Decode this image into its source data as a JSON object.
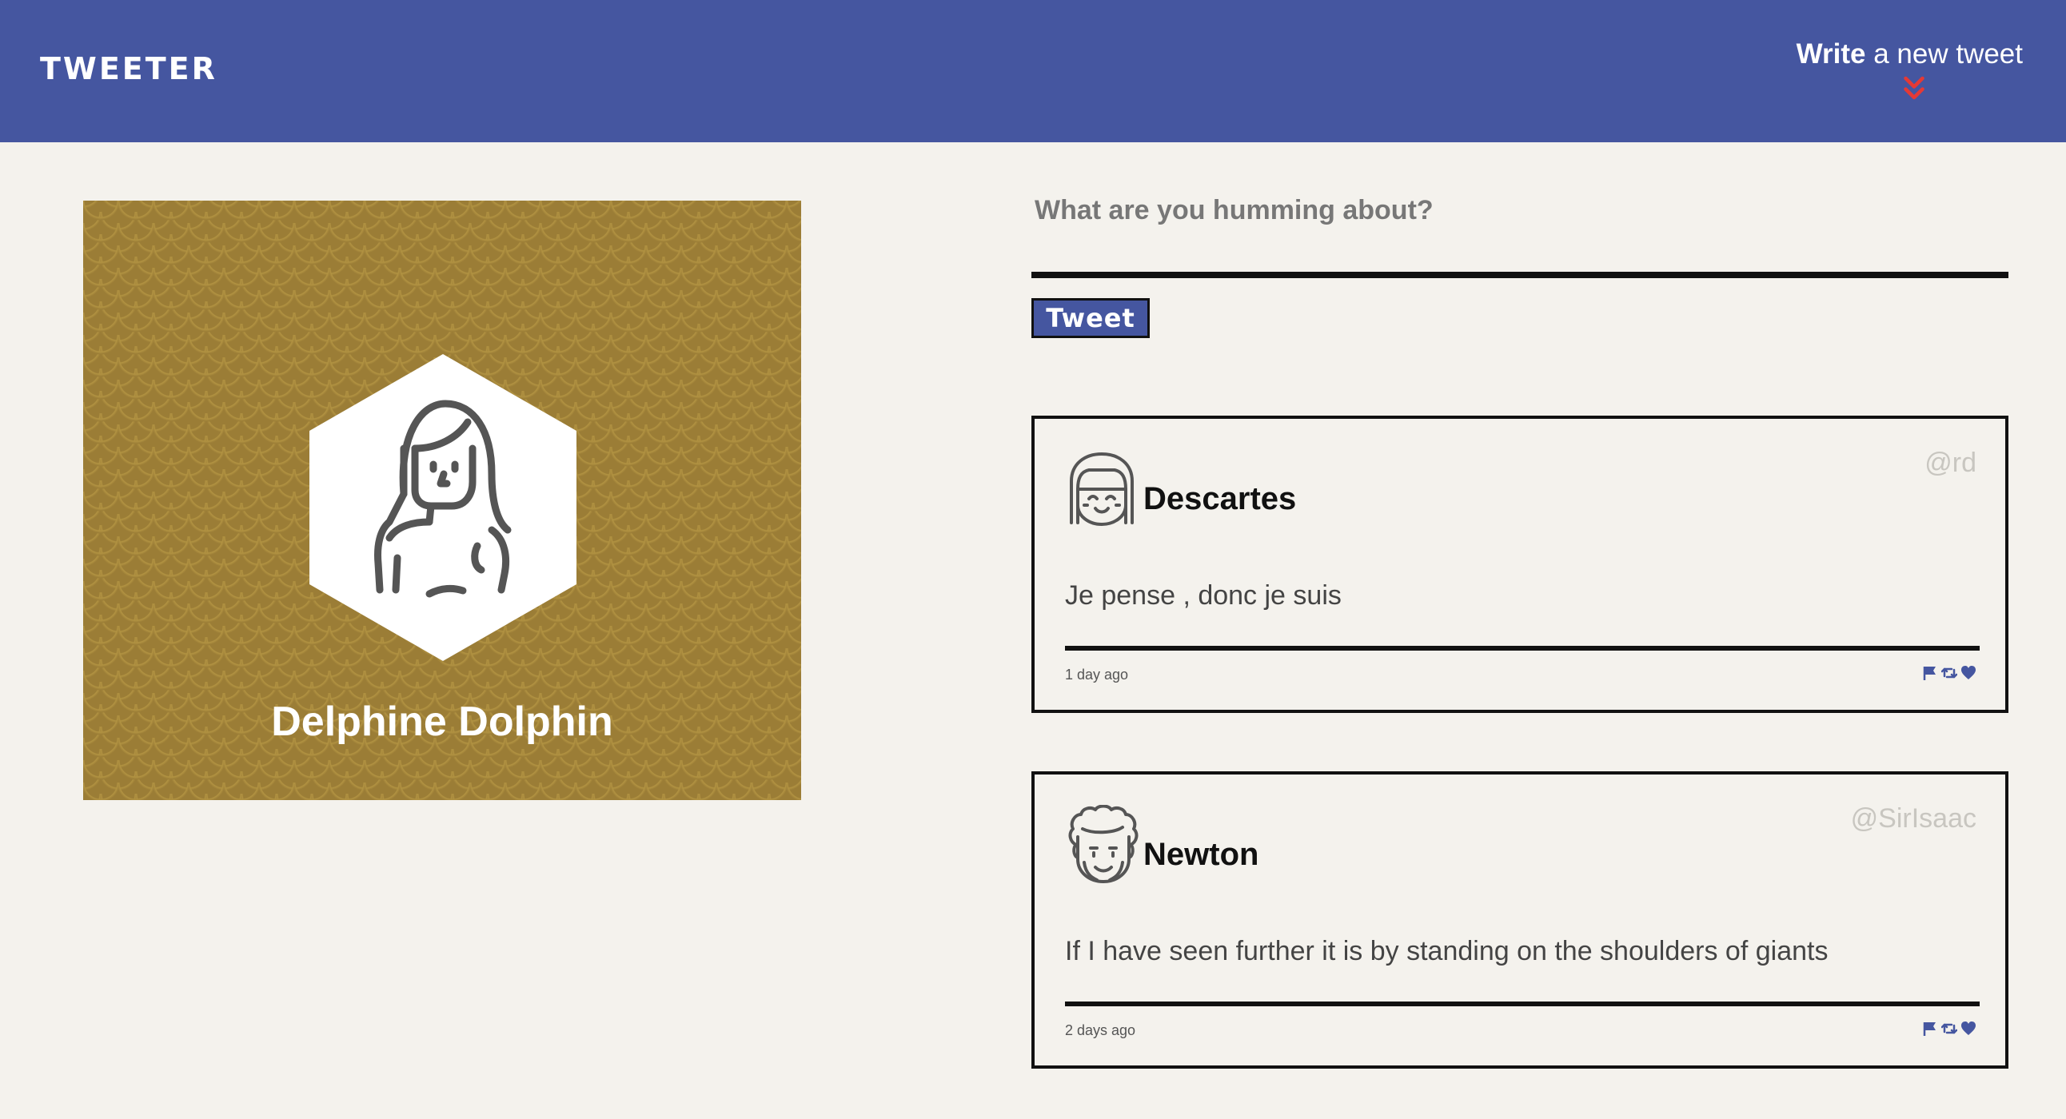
{
  "nav": {
    "brand": "Tweeter",
    "compose_strong": "Write",
    "compose_rest": " a new tweet",
    "compose_arrow_icon": "double-chevron-down-icon",
    "compose_arrow_color": "#e53935"
  },
  "theme": {
    "nav_bg": "#4556a0",
    "page_bg": "#f4f2ed",
    "profile_bg": "#9b7d36"
  },
  "profile": {
    "name": "Delphine Dolphin",
    "avatar_icon": "woman-avatar-icon"
  },
  "composer": {
    "placeholder": "What are you humming about?",
    "value": "",
    "button_label": "Tweet"
  },
  "tweets": [
    {
      "author": "Descartes",
      "handle": "@rd",
      "text": "Je pense , donc je suis",
      "time": "1 day ago",
      "avatar_icon": "girl-bangs-avatar-icon"
    },
    {
      "author": "Newton",
      "handle": "@SirIsaac",
      "text": "If I have seen further it is by standing on the shoulders of giants",
      "time": "2 days ago",
      "avatar_icon": "curly-hair-avatar-icon"
    }
  ],
  "actions": {
    "flag_icon": "flag-icon",
    "retweet_icon": "retweet-icon",
    "like_icon": "heart-icon",
    "color": "#4556a0"
  }
}
